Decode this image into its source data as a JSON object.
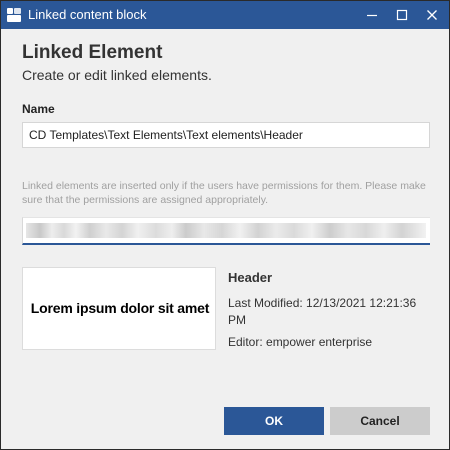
{
  "window": {
    "title": "Linked content block",
    "accent_color": "#2b5797",
    "controls": [
      "minimize-icon",
      "maximize-icon",
      "close-icon"
    ]
  },
  "dialog": {
    "heading": "Linked Element",
    "subheading": "Create or edit linked elements.",
    "name_label": "Name",
    "name_value": "CD Templates\\Text Elements\\Text elements\\Header",
    "info_text": "Linked elements are inserted only if the users have permissions for them. Please make sure that the permissions are assigned appropriately."
  },
  "preview": {
    "text": "Lorem ipsum dolor sit amet"
  },
  "details": {
    "title": "Header",
    "last_modified": "Last Modified: 12/13/2021 12:21:36 PM",
    "editor": "Editor: empower enterprise"
  },
  "buttons": {
    "ok": "OK",
    "cancel": "Cancel"
  }
}
